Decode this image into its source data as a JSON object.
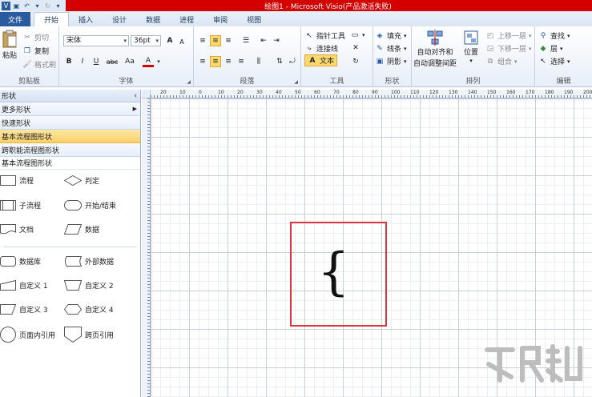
{
  "window": {
    "title": "绘图1 - Microsoft Visio(产品激活失败)"
  },
  "tabs": [
    {
      "label": "文件"
    },
    {
      "label": "开始"
    },
    {
      "label": "插入"
    },
    {
      "label": "设计"
    },
    {
      "label": "数据"
    },
    {
      "label": "进程"
    },
    {
      "label": "审阅"
    },
    {
      "label": "视图"
    }
  ],
  "clipboard": {
    "paste": "粘贴",
    "cut": "剪切",
    "copy": "复制",
    "format_painter": "格式刷",
    "label": "剪贴板"
  },
  "font": {
    "name": "宋体",
    "size": "36pt",
    "label": "字体",
    "bold": "B",
    "italic": "I",
    "underline": "U",
    "strike": "abc",
    "case": "Aa",
    "color": "A",
    "grow": "A",
    "shrink": "A"
  },
  "paragraph": {
    "label": "段落"
  },
  "tools": {
    "pointer": "指针工具",
    "connector": "连接线",
    "text": "文本",
    "label": "工具"
  },
  "shape": {
    "fill": "填充",
    "line": "线条",
    "shadow": "阴影",
    "label": "形状"
  },
  "arrange": {
    "auto_align_1": "自动对齐和",
    "auto_align_2": "自动调整间距",
    "position": "位置",
    "bring_forward": "上移一层",
    "send_backward": "下移一层",
    "group": "组合",
    "label": "排列"
  },
  "editing": {
    "find": "查找",
    "layers": "层",
    "select": "选择",
    "label": "编辑"
  },
  "shapes_panel": {
    "header": "形状",
    "more_shapes": "更多形状",
    "quick_shapes": "快速形状",
    "basic_flowchart": "基本流程图形状",
    "cross_functional": "跨职能流程图形状",
    "stencil_title": "基本流程图形状",
    "items": [
      {
        "label": "流程"
      },
      {
        "label": "判定"
      },
      {
        "label": "子流程"
      },
      {
        "label": "开始/结束"
      },
      {
        "label": "文档"
      },
      {
        "label": "数据"
      },
      {
        "label": "数据库"
      },
      {
        "label": "外部数据"
      },
      {
        "label": "自定义 1"
      },
      {
        "label": "自定义 2"
      },
      {
        "label": "自定义 3"
      },
      {
        "label": "自定义 4"
      },
      {
        "label": "页面内引用"
      },
      {
        "label": "跨页引用"
      }
    ]
  },
  "ruler": {
    "labels": [
      "20",
      "10",
      "0",
      "10",
      "20",
      "30",
      "40",
      "50",
      "60",
      "70",
      "80",
      "90",
      "100",
      "110",
      "120",
      "130",
      "140",
      "150",
      "160",
      "170",
      "180",
      "190",
      "200"
    ]
  },
  "canvas": {
    "text_content": "{"
  },
  "colors": {
    "title_bar": "#d40000",
    "file_tab": "#2a5b9f",
    "selection": "#d9363e",
    "highlight": "#fbd96f"
  }
}
